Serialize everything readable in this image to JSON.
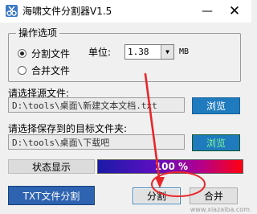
{
  "window": {
    "title": "海啸文件分割器V1.5",
    "minimize_glyph": "—",
    "close_glyph": "✕"
  },
  "options": {
    "group_title": "操作选项",
    "split_label": "分割文件",
    "merge_label": "合并文件",
    "split_checked": true,
    "unit_label": "单位:",
    "unit_value": "1.38",
    "unit_suffix": "MB"
  },
  "source": {
    "label": "请选择源文件:",
    "value": "D:\\tools\\桌面\\新建文本文档.txt",
    "browse_label": "浏览"
  },
  "target": {
    "label": "请选择保存到的目标文件夹:",
    "value": "D:\\tools\\桌面\\下载吧",
    "browse_label": "浏览"
  },
  "status": {
    "label": "状态显示",
    "progress_text": "100 %",
    "progress_fraction": 1.0
  },
  "buttons": {
    "txt_split": "TXT文件分割",
    "split": "分割",
    "merge": "合并"
  },
  "annotation": {
    "color": "#e8262a"
  },
  "watermark": "www.xiazaiba.com",
  "icons": {
    "app": "scissors-app-icon",
    "dropdown": "chevron-down-icon"
  }
}
